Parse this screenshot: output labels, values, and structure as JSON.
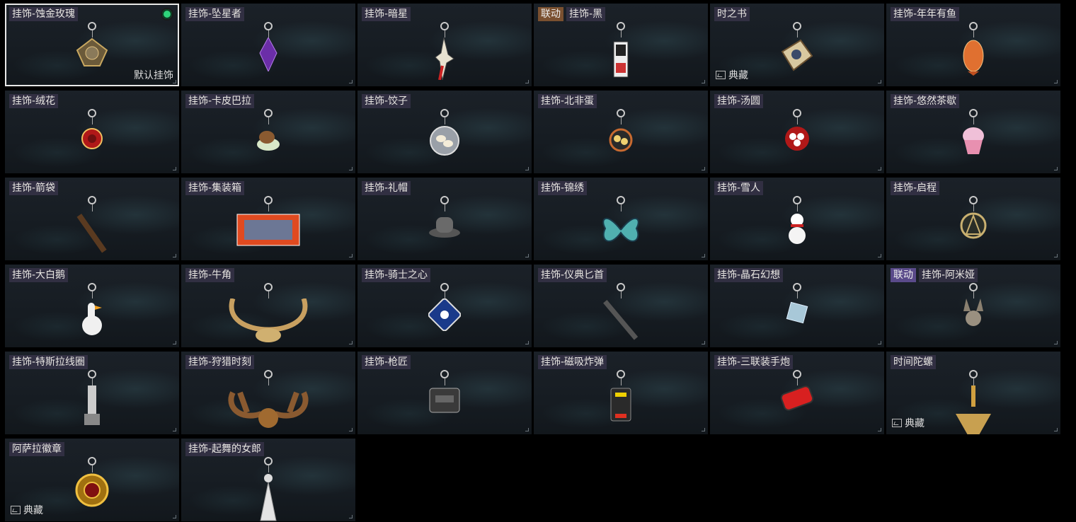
{
  "charms": [
    {
      "name": "挂饰-蚀金玫瑰",
      "tag": null,
      "selected": true,
      "footer": "默认挂饰",
      "icon": "gilded-rose-charm-icon"
    },
    {
      "name": "挂饰-坠星者",
      "tag": null,
      "icon": "purple-crystal-charm-icon"
    },
    {
      "name": "挂饰-暗星",
      "tag": null,
      "icon": "dark-star-charm-icon"
    },
    {
      "name": "挂饰-黑",
      "tag": "联动",
      "tagColor": "#7a5030",
      "icon": "black-card-charm-icon"
    },
    {
      "name": "时之书",
      "tag": null,
      "footer": "典藏",
      "icon": "book-of-time-charm-icon"
    },
    {
      "name": "挂饰-年年有鱼",
      "tag": null,
      "icon": "fish-charm-icon"
    },
    {
      "name": "挂饰-绒花",
      "icon": "velvet-flower-charm-icon"
    },
    {
      "name": "挂饰-卡皮巴拉",
      "icon": "capybara-charm-icon"
    },
    {
      "name": "挂饰-饺子",
      "icon": "dumpling-charm-icon"
    },
    {
      "name": "挂饰-北非蛋",
      "icon": "shakshuka-charm-icon"
    },
    {
      "name": "挂饰-汤圆",
      "icon": "tangyuan-charm-icon"
    },
    {
      "name": "挂饰-悠然茶歇",
      "icon": "cupcake-charm-icon"
    },
    {
      "name": "挂饰-箭袋",
      "icon": "quiver-charm-icon"
    },
    {
      "name": "挂饰-集装箱",
      "icon": "container-charm-icon"
    },
    {
      "name": "挂饰-礼帽",
      "icon": "hat-charm-icon"
    },
    {
      "name": "挂饰-锦绣",
      "icon": "butterfly-charm-icon"
    },
    {
      "name": "挂饰-雪人",
      "icon": "snowman-charm-icon"
    },
    {
      "name": "挂饰-启程",
      "icon": "compass-charm-icon"
    },
    {
      "name": "挂饰-大白鹅",
      "icon": "goose-charm-icon"
    },
    {
      "name": "挂饰-牛角",
      "icon": "horns-charm-icon"
    },
    {
      "name": "挂饰-骑士之心",
      "icon": "knight-heart-charm-icon"
    },
    {
      "name": "挂饰-仪典匕首",
      "icon": "dagger-charm-icon"
    },
    {
      "name": "挂饰-晶石幻想",
      "icon": "crystal-cube-charm-icon"
    },
    {
      "name": "挂饰-阿米娅",
      "tag": "联动",
      "tagColor": "#5a4a8a",
      "icon": "amiya-charm-icon"
    },
    {
      "name": "挂饰-特斯拉线圈",
      "icon": "tesla-coil-charm-icon"
    },
    {
      "name": "挂饰-狩猎时刻",
      "icon": "antlers-charm-icon"
    },
    {
      "name": "挂饰-枪匠",
      "icon": "gun-case-charm-icon"
    },
    {
      "name": "挂饰-磁吸炸弹",
      "icon": "magnet-bomb-charm-icon"
    },
    {
      "name": "挂饰-三联装手炮",
      "icon": "hand-cannon-charm-icon"
    },
    {
      "name": "时间陀螺",
      "footer": "典藏",
      "icon": "spinning-top-charm-icon"
    },
    {
      "name": "阿萨拉徽章",
      "footer": "典藏",
      "icon": "badge-charm-icon"
    },
    {
      "name": "挂饰-起舞的女郎",
      "icon": "dancer-charm-icon"
    }
  ]
}
